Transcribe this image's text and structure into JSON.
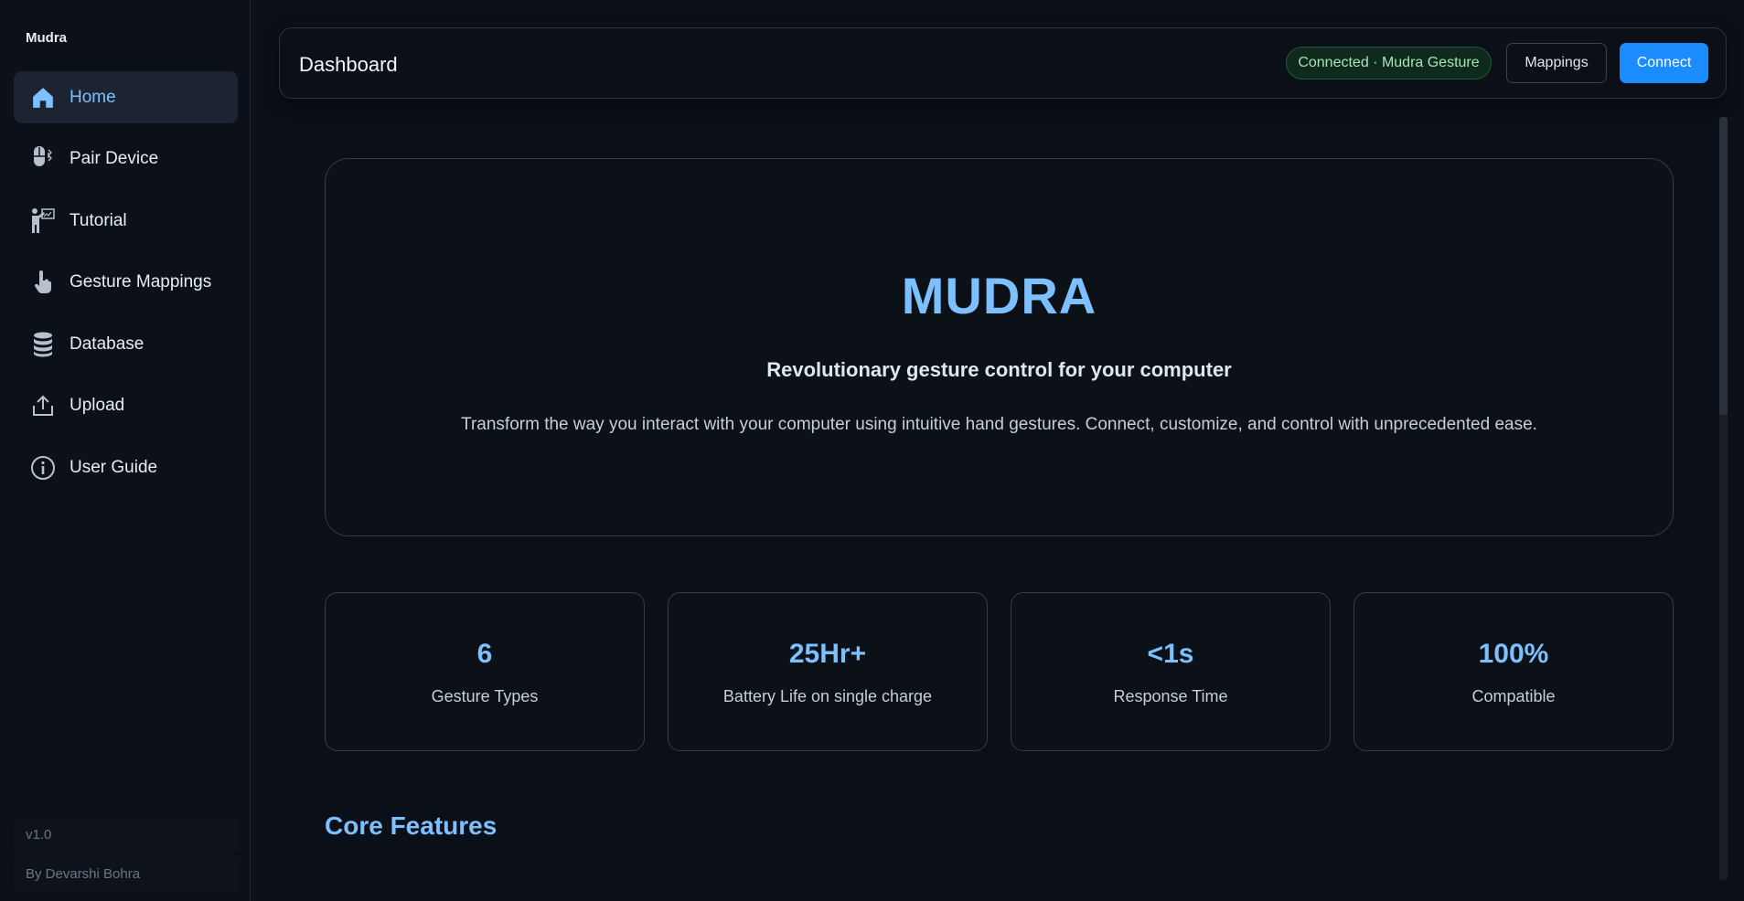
{
  "app": {
    "brand": "Mudra"
  },
  "sidebar": {
    "items": [
      {
        "label": "Home",
        "icon": "home-icon",
        "active": true
      },
      {
        "label": "Pair Device",
        "icon": "mouse-icon"
      },
      {
        "label": "Tutorial",
        "icon": "presenter-icon"
      },
      {
        "label": "Gesture Mappings",
        "icon": "pointer-hand-icon"
      },
      {
        "label": "Database",
        "icon": "database-icon"
      },
      {
        "label": "Upload",
        "icon": "upload-icon"
      },
      {
        "label": "User Guide",
        "icon": "info-icon"
      }
    ],
    "version": "v1.0",
    "author": "By Devarshi Bohra"
  },
  "header": {
    "title": "Dashboard",
    "status_badge": "Connected · Mudra Gesture",
    "mappings_label": "Mappings",
    "connect_label": "Connect"
  },
  "hero": {
    "title": "MUDRA",
    "subtitle": "Revolutionary gesture control for your computer",
    "description": "Transform the way you interact with your computer using intuitive hand gestures. Connect, customize, and control with unprecedented ease."
  },
  "stats": [
    {
      "value": "6",
      "label": "Gesture Types"
    },
    {
      "value": "25Hr+",
      "label": "Battery Life on single charge"
    },
    {
      "value": "<1s",
      "label": "Response Time"
    },
    {
      "value": "100%",
      "label": "Compatible"
    }
  ],
  "sections": {
    "core_features": "Core Features"
  },
  "colors": {
    "accent": "#7cc0ff",
    "primary_button": "#1a8cff",
    "status_green": "#a7e3b9",
    "background": "#0b0f17"
  }
}
